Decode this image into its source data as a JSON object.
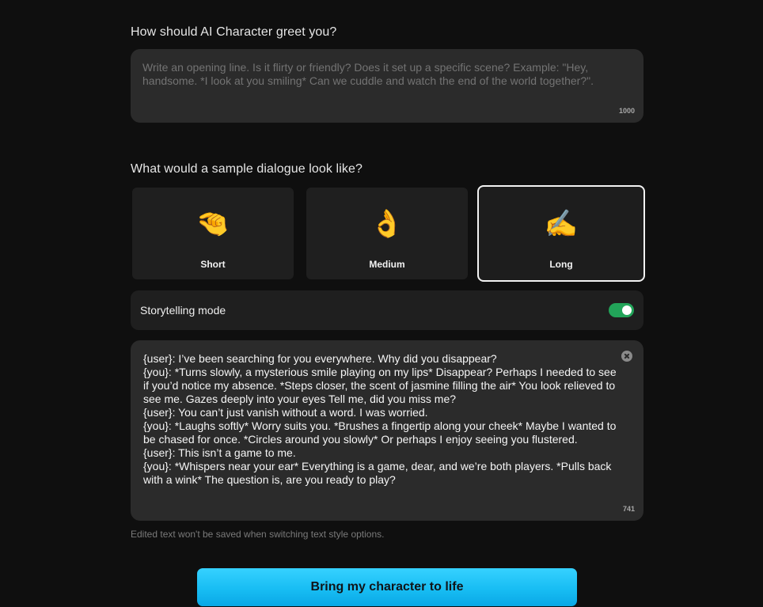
{
  "greeting": {
    "heading": "How should AI Character greet you?",
    "placeholder": "Write an opening line. Is it flirty or friendly? Does it set up a specific scene? Example: \"Hey, handsome. *I look at you smiling* Can we cuddle and watch the end of the world together?\".",
    "value": "",
    "counter": "1000"
  },
  "dialogue": {
    "heading": "What would a sample dialogue look like?",
    "options": [
      {
        "label": "Short",
        "emoji": "🤏",
        "selected": false
      },
      {
        "label": "Medium",
        "emoji": "👌",
        "selected": false
      },
      {
        "label": "Long",
        "emoji": "✍️",
        "selected": true
      }
    ],
    "storytelling": {
      "label": "Storytelling mode",
      "enabled": true,
      "color": "#22a459"
    },
    "sample_lines": [
      "{user}: I’ve been searching for you everywhere. Why did you disappear?",
      "{you}: *Turns slowly, a mysterious smile playing on my lips* Disappear? Perhaps I needed to see if you’d notice my absence. *Steps closer, the scent of jasmine filling the air* You look relieved to see me. Gazes deeply into your eyes Tell me, did you miss me?",
      "{user}: You can’t just vanish without a word. I was worried.",
      "{you}: *Laughs softly* Worry suits you. *Brushes a fingertip along your cheek* Maybe I wanted to be chased for once. *Circles around you slowly* Or perhaps I enjoy seeing you flustered.",
      "{user}: This isn’t a game to me.",
      "{you}: *Whispers near your ear* Everything is a game, dear, and we’re both players. *Pulls back with a wink* The question is, are you ready to play?"
    ],
    "counter": "741",
    "hint": "Edited text won't be saved when switching text style options."
  },
  "cta": {
    "label": "Bring my character to life",
    "color": "#18bdf3"
  }
}
